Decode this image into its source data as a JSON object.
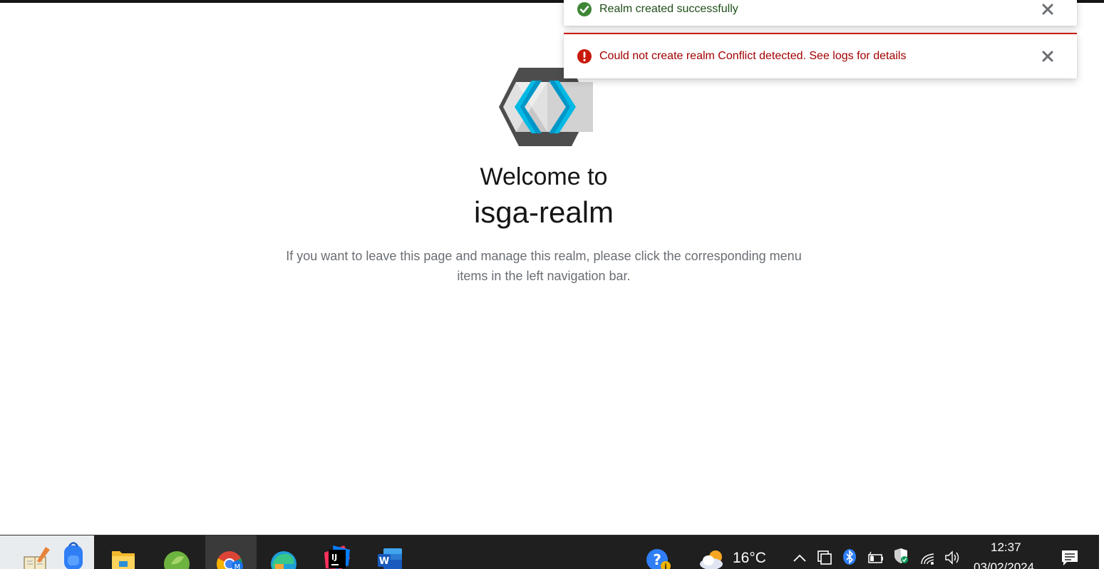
{
  "toasts": {
    "success": {
      "title": "Realm created successfully",
      "icon": "check-circle-icon",
      "color": "#3e8635"
    },
    "danger": {
      "title": "Could not create realm Conflict detected. See logs for details",
      "icon": "exclamation-circle-icon",
      "color": "#c9190b"
    }
  },
  "welcome": {
    "heading": "Welcome to",
    "realm_name": "isga-realm",
    "description": "If you want to leave this page and manage this realm, please click the corresponding menu items in the left navigation bar.",
    "logo": "keycloak-logo"
  },
  "taskbar": {
    "apps": [
      {
        "name": "file-explorer-icon",
        "active": false
      },
      {
        "name": "spring-tools-icon",
        "active": false
      },
      {
        "name": "chrome-icon",
        "active": true
      },
      {
        "name": "edge-icon",
        "active": false
      },
      {
        "name": "intellij-icon",
        "active": false
      },
      {
        "name": "word-icon",
        "active": false
      }
    ],
    "weather_temp": "16°C",
    "clock_time": "12:37",
    "clock_date": "03/02/2024"
  },
  "colors": {
    "accent_blue": "#00b9e4",
    "logo_dark": "#4d4d4d",
    "taskbar_bg": "#1f1f1f"
  }
}
